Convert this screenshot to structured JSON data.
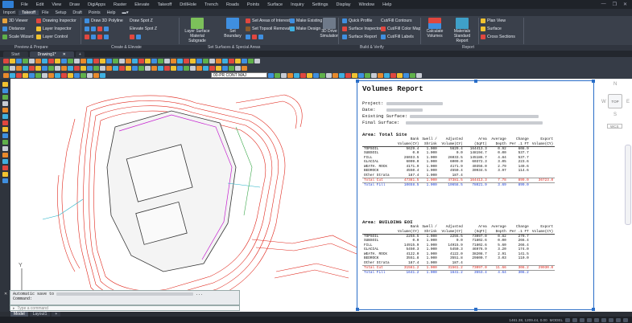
{
  "menubar": {
    "items": [
      "File",
      "Edit",
      "View",
      "Draw",
      "DigiApps",
      "Raster",
      "Elevate",
      "Takeoff",
      "DrillHole",
      "Trench",
      "Roads",
      "Points",
      "Surface",
      "Inquiry",
      "Settings",
      "Display",
      "Window",
      "Help"
    ]
  },
  "ribbon_tabs": [
    "Import",
    "Takeoff",
    "File",
    "Setup",
    "Draft",
    "Points",
    "Help"
  ],
  "ribbon_active_tab": "Takeoff",
  "ribbon": {
    "preview": [
      "3D Viewer",
      "Distance",
      "Scale Wizard"
    ],
    "layers": [
      "Drawing Inspector",
      "Layer Inspector",
      "Layer Control"
    ],
    "draw3d": "Draw 3D Polyline",
    "draw_spot": "Draw Spot Z",
    "elevate_spot": "Elevate Spot Z",
    "layer_surface": "Layer Surface",
    "material_subgrade": "Material Subgrade",
    "set_boundary": "Set Boundary",
    "set_area_interest": "Set Areas of Interest",
    "set_topsoil": "Set Topsoil Removal",
    "make_existing": "Make Existing",
    "make_design": "Make Design",
    "drive_3d": "3D Drive Simulation",
    "quick_profile": "Quick Profile",
    "surface_inspector": "Surface Inspector",
    "surface_report": "Surface Report",
    "cut_fill_contours": "Cut/Fill Contours",
    "cut_fill_color": "Cut/Fill Color Map",
    "cut_fill_labels": "Cut/Fill Labels",
    "calc_volumes": "Calculate Volumes",
    "materials_report": "Materials Standard Report",
    "plan_view": "Plan View",
    "surface": "Surface",
    "cross_sections": "Cross Sections",
    "panels": [
      "Preview & Prepare",
      "Create & Elevate",
      "Set Surfaces & Special Areas",
      "Build & Verify",
      "Report"
    ]
  },
  "doc_tabs": [
    "Start",
    "Drawing1*"
  ],
  "layer_combo": "00-PR CONT MAJ",
  "report": {
    "title": "Volumes Report",
    "labels": {
      "project": "Project:",
      "date": "Date:",
      "existing": "Existing Surface:",
      "final": "Final Surface:"
    },
    "columns_top": [
      "",
      "Bank",
      "Swell /",
      "Adjusted",
      "Area",
      "Average",
      "Change",
      "Export"
    ],
    "columns_bottom": [
      "",
      "Volume(CY)",
      "Shrink",
      "Volume(CY)",
      "(SqFt)",
      "Depth",
      "Per .1 FT",
      "Volume(CY)"
    ],
    "sections": [
      {
        "name": "Area: Total Site",
        "rows": [
          [
            "TOPSOIL",
            "5629.4",
            "1.000",
            "5629.4",
            "164413.3",
            "0.92",
            "608.9",
            ""
          ],
          [
            "SUBSOIL",
            "0.0",
            "1.000",
            "0.0",
            "148194.7",
            "0.00",
            "537.7",
            ""
          ],
          [
            "FILL",
            "26033.5",
            "1.000",
            "26033.5",
            "145186.7",
            "4.84",
            "537.7",
            ""
          ],
          [
            "GLACIAL",
            "6009.0",
            "1.000",
            "6009.0",
            "60372.3",
            "3.05",
            "223.6",
            ""
          ],
          [
            "WEATH. ROCK",
            "4171.9",
            "1.000",
            "4171.9",
            "40356.0",
            "2.79",
            "149.6",
            ""
          ],
          [
            "BEDROCK",
            "4550.4",
            "1.000",
            "4550.4",
            "30934.5",
            "3.97",
            "114.6",
            ""
          ],
          [
            "Other Strata",
            "187.4",
            "1.000",
            "187.4",
            "",
            "",
            "",
            ""
          ]
        ],
        "total_cut": [
          "Total Cut",
          "47381.5",
          "1.000",
          "47381.5",
          "164413.3",
          "7.78",
          "899.0",
          "36723.0"
        ],
        "total_fill": [
          "Total Fill",
          "10658.5",
          "1.000",
          "10658.5",
          "78021.9",
          "3.69",
          "899.0",
          ""
        ]
      },
      {
        "name": "Area: BUILDING EOI",
        "rows": [
          [
            "TOPSOIL",
            "2255.5",
            "1.000",
            "2255.5",
            "73097.0",
            "0.82",
            "270.7",
            ""
          ],
          [
            "SUBSOIL",
            "0.0",
            "1.000",
            "0.0",
            "71802.6",
            "0.00",
            "266.4",
            ""
          ],
          [
            "FILL",
            "14915.9",
            "1.000",
            "14915.9",
            "71802.6",
            "5.60",
            "266.4",
            ""
          ],
          [
            "GLACIAL",
            "5450.3",
            "1.000",
            "5450.3",
            "46976.9",
            "3.20",
            "174.0",
            ""
          ],
          [
            "WEATH. ROCK",
            "4122.0",
            "1.000",
            "4122.0",
            "38208.7",
            "2.91",
            "141.5",
            ""
          ],
          [
            "BEDROCK",
            "3551.8",
            "1.000",
            "3551.8",
            "29800.7",
            "3.03",
            "110.0",
            ""
          ],
          [
            "Other Strata",
            "187.4",
            "1.000",
            "187.4",
            "",
            "",
            "",
            ""
          ]
        ],
        "total_cut": [
          "Total Cut",
          "31561.2",
          "1.000",
          "31561.2",
          "73097.0",
          "11.66",
          "306.2",
          "29930.0"
        ],
        "total_fill": [
          "Total Fill",
          "1641.2",
          "1.000",
          "1641.2",
          "3553.4",
          "4.64",
          "306.2",
          ""
        ]
      }
    ]
  },
  "viewcube": {
    "north": "N",
    "west": "W",
    "east": "E",
    "south": "S",
    "top": "TOP",
    "wcs": "WCS"
  },
  "ucs": {
    "y": "Y",
    "x": "X"
  },
  "command": {
    "history_line1": "Automatic save to",
    "history_line2": "Command:",
    "placeholder": "Type a command"
  },
  "layout_tabs": [
    "Model",
    "Layout1"
  ],
  "status": {
    "coords": "1461.38, 1209.44, 0.00",
    "mode": "MODEL"
  }
}
